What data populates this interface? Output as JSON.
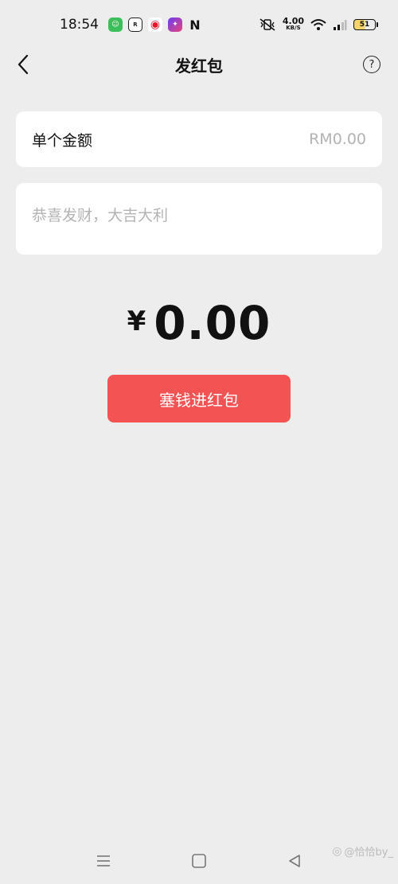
{
  "status_bar": {
    "time": "18:54",
    "speed_value": "4.00",
    "speed_unit": "KB/S",
    "battery": "51"
  },
  "nav": {
    "title": "发红包",
    "help_icon": "?"
  },
  "amount_row": {
    "label": "单个金额",
    "value": "RM0.00"
  },
  "greeting": {
    "placeholder": "恭喜发财，大吉大利"
  },
  "total": {
    "currency": "¥",
    "amount": "0.00"
  },
  "send_button": {
    "label": "塞钱进红包"
  },
  "watermark": {
    "text": "@恰恰by_"
  },
  "colors": {
    "background": "#ededed",
    "button": "#f45353",
    "card": "#ffffff",
    "placeholder": "#b3b3b3"
  }
}
